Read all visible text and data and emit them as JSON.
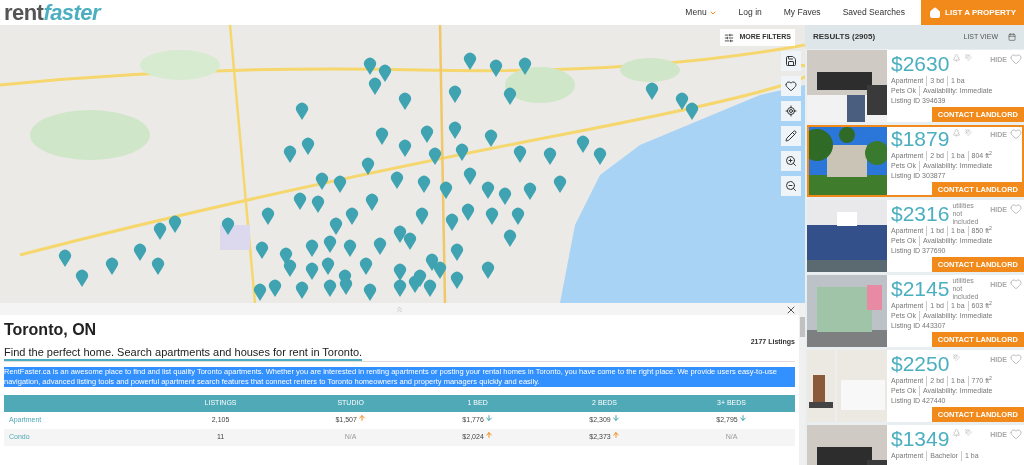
{
  "header": {
    "logo_left": "rent",
    "logo_right": "faster",
    "nav": [
      {
        "label": "Menu",
        "dropdown": true
      },
      {
        "label": "Log in",
        "dropdown": false
      },
      {
        "label": "My Faves",
        "dropdown": false
      },
      {
        "label": "Saved Searches",
        "dropdown": false
      }
    ],
    "cta": "LIST A PROPERTY"
  },
  "map": {
    "more_filters": "MORE FILTERS"
  },
  "results": {
    "title": "RESULTS (2905)",
    "view": "LIST VIEW",
    "listings": [
      {
        "price": "$2630",
        "selected": false,
        "pets_icon": true,
        "utilities_icon": true,
        "specs": [
          "Apartment",
          "3 bd",
          "1 ba"
        ],
        "line2": [
          "Pets Ok",
          "Availability: Immediate"
        ],
        "listing_id": "Listing ID 394639",
        "hide": "HIDE",
        "contact": "CONTACT LANDLORD"
      },
      {
        "price": "$1879",
        "selected": true,
        "pets_icon": true,
        "utilities_icon": true,
        "specs": [
          "Apartment",
          "2 bd",
          "1 ba",
          "804 ft$^{2}$"
        ],
        "line2": [
          "Pets Ok",
          "Availability: Immediate"
        ],
        "listing_id": "Listing ID 303877",
        "hide": "HIDE",
        "contact": "CONTACT LANDLORD"
      },
      {
        "price": "$2316",
        "selected": false,
        "pets_icon": false,
        "utilities_icon": false,
        "utilities_note": "utilities not included",
        "specs": [
          "Apartment",
          "1 bd",
          "1 ba",
          "850 ft$^{2}$"
        ],
        "line2": [
          "Pets Ok",
          "Availability: Immediate"
        ],
        "listing_id": "Listing ID 377690",
        "hide": "HIDE",
        "contact": "CONTACT LANDLORD"
      },
      {
        "price": "$2145",
        "selected": false,
        "pets_icon": false,
        "utilities_icon": false,
        "utilities_note": "utilities not included",
        "specs": [
          "Apartment",
          "1 bd",
          "1 ba",
          "603 ft$^{2}$"
        ],
        "line2": [
          "Pets Ok",
          "Availability: Immediate"
        ],
        "listing_id": "Listing ID 443307",
        "hide": "HIDE",
        "contact": "CONTACT LANDLORD"
      },
      {
        "price": "$2250",
        "selected": false,
        "pets_icon": false,
        "utilities_icon": true,
        "specs": [
          "Apartment",
          "2 bd",
          "1 ba",
          "770 ft$^{2}$"
        ],
        "line2": [
          "Pets Ok",
          "Availability: Immediate"
        ],
        "listing_id": "Listing ID 427440",
        "hide": "HIDE",
        "contact": "CONTACT LANDLORD"
      },
      {
        "price": "$1349",
        "selected": false,
        "pets_icon": true,
        "utilities_icon": true,
        "specs": [
          "Apartment",
          "Bachelor",
          "1 ba"
        ],
        "hide": "HIDE"
      }
    ]
  },
  "info": {
    "title": "Toronto, ON",
    "count": "2177 Listings",
    "subtitle": "Find the perfect home. Search apartments and houses for rent in Toronto.",
    "paragraph": "RentFaster.ca is an awesome place to find and list quality Toronto apartments. Whether you are interested in renting apartments or posting your rental homes in Toronto, you have come to the right place. We provide users easy-to-use navigation, advanced listing tools and powerful apartment search features that connect renters to Toronto homeowners and property managers quickly and easily.",
    "paragraph_selected": true,
    "table": {
      "columns": [
        "LISTINGS",
        "STUDIO",
        "1 BED",
        "2 BEDS",
        "3+ BEDS"
      ],
      "rows": [
        {
          "type": "Apartment",
          "listings": "2,105",
          "prices": [
            {
              "text": "$1,507",
              "rising": true
            },
            {
              "text": "$1,776",
              "rising": false
            },
            {
              "text": "$2,309",
              "rising": false
            },
            {
              "text": "$2,795",
              "rising": false
            }
          ]
        },
        {
          "type": "Condo",
          "listings": "11",
          "prices": [
            {
              "text": "N/A"
            },
            {
              "text": "$2,024",
              "rising": true
            },
            {
              "text": "$2,373",
              "rising": true
            },
            {
              "text": "N/A"
            }
          ]
        }
      ]
    }
  }
}
